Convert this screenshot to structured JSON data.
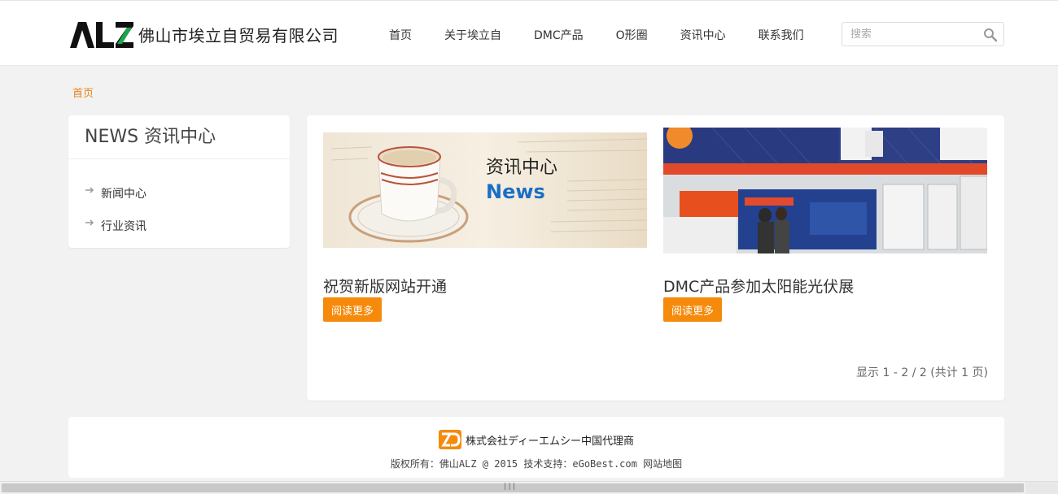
{
  "header": {
    "company_name": "佛山市埃立自贸易有限公司",
    "nav": [
      "首页",
      "关于埃立自",
      "DMC产品",
      "O形圈",
      "资讯中心",
      "联系我们"
    ],
    "search_placeholder": "搜索"
  },
  "breadcrumb": "首页",
  "sidebar": {
    "title": "NEWS 资讯中心",
    "items": [
      "新闻中心",
      "行业资讯"
    ]
  },
  "news": [
    {
      "title": "祝贺新版网站开通",
      "read_more": "阅读更多",
      "thumb_heading": "资讯中心",
      "thumb_sub": "News"
    },
    {
      "title": "DMC产品参加太阳能光伏展",
      "read_more": "阅读更多"
    }
  ],
  "pagination": "显示 1 - 2 / 2 (共计 1 页)",
  "footer": {
    "brand": "株式会社ディーエムシー中国代理商",
    "copyright": "版权所有：佛山ALZ @ 2015 技术支持：eGoBest.com 网站地图"
  },
  "colors": {
    "accent": "#f58a0b",
    "breadcrumb": "#e8851c",
    "logo_green": "#1aa64a"
  }
}
